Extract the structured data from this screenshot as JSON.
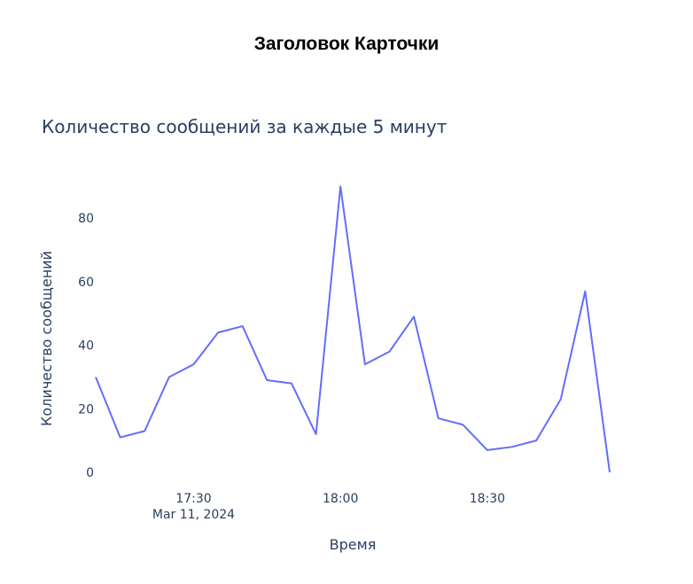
{
  "card": {
    "title": "Заголовок Карточки"
  },
  "chart_data": {
    "type": "line",
    "title": "Количество сообщений за каждые 5 минут",
    "xlabel": "Время",
    "ylabel": "Количество сообщений",
    "x_ticks": [
      {
        "label": "17:30",
        "sublabel": "Mar 11, 2024",
        "minute": 30
      },
      {
        "label": "18:00",
        "sublabel": "",
        "minute": 60
      },
      {
        "label": "18:30",
        "sublabel": "",
        "minute": 90
      }
    ],
    "y_ticks": [
      0,
      20,
      40,
      60,
      80
    ],
    "ylim": [
      0,
      94
    ],
    "xlim_minutes_after_17": [
      10,
      115
    ],
    "grid": false,
    "line_color": "#636efa",
    "series": [
      {
        "name": "",
        "x": [
          "17:10",
          "17:15",
          "17:20",
          "17:25",
          "17:30",
          "17:35",
          "17:40",
          "17:45",
          "17:50",
          "17:55",
          "18:00",
          "18:05",
          "18:10",
          "18:15",
          "18:20",
          "18:25",
          "18:30",
          "18:35",
          "18:40",
          "18:45",
          "18:50",
          "18:55"
        ],
        "values": [
          30,
          11,
          13,
          30,
          34,
          44,
          46,
          29,
          28,
          12,
          90,
          34,
          38,
          49,
          17,
          15,
          7,
          8,
          10,
          23,
          57,
          0
        ]
      }
    ]
  }
}
